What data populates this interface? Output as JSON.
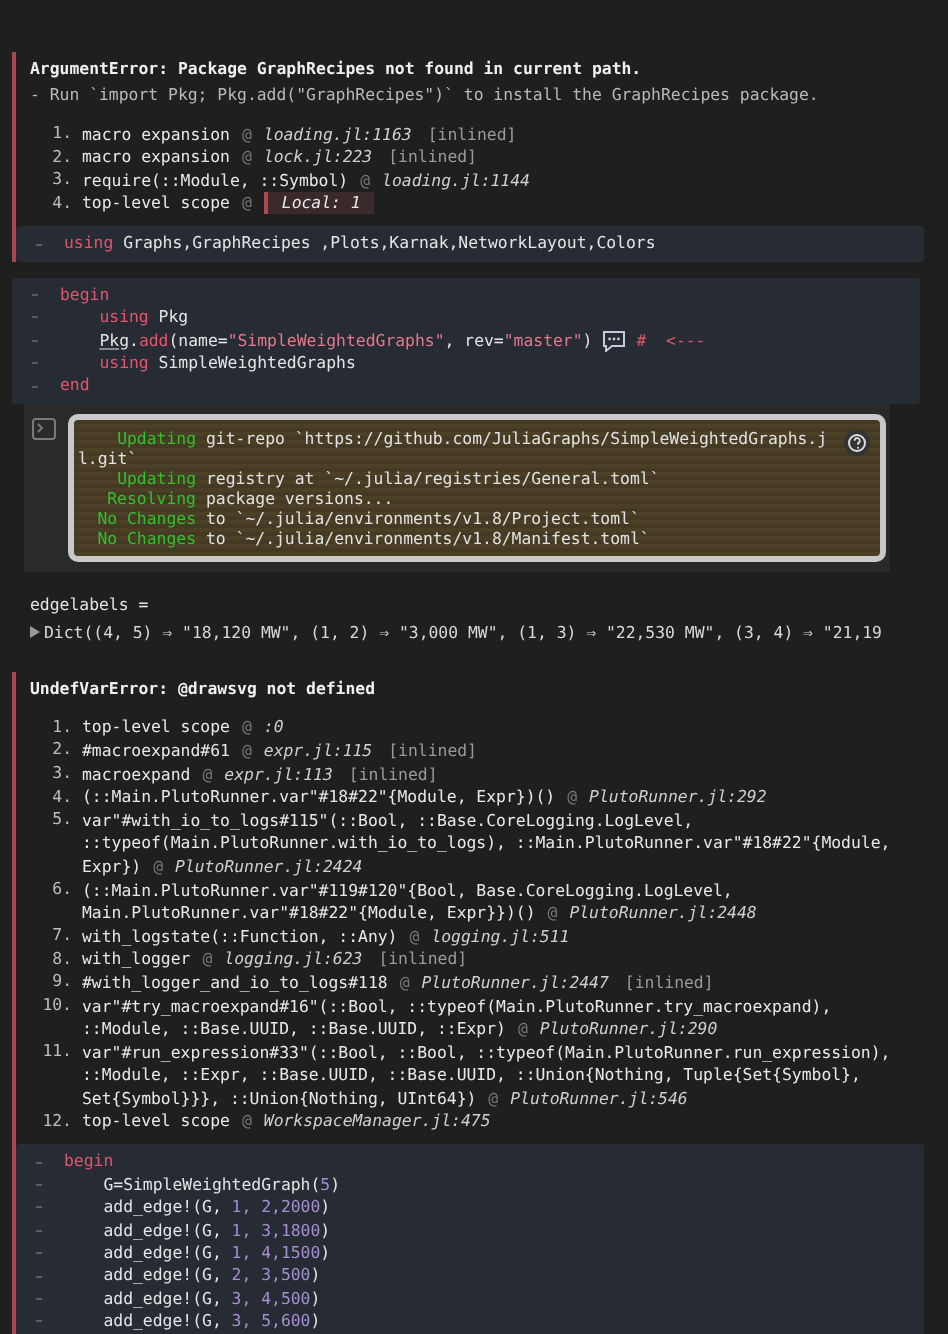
{
  "cells": [
    {
      "error": {
        "title": "ArgumentError: Package GraphRecipes not found in current path.",
        "hint": "- Run `import Pkg; Pkg.add(\"GraphRecipes\")` to install the GraphRecipes package.",
        "frames": [
          {
            "num": "1.",
            "call": [
              "macro expansion"
            ],
            "at": "@",
            "loc": {
              "kind": "file",
              "text": "loading.jl:1163"
            },
            "tag": "[inlined]"
          },
          {
            "num": "2.",
            "call": [
              "macro expansion"
            ],
            "at": "@",
            "loc": {
              "kind": "file",
              "text": "lock.jl:223"
            },
            "tag": "[inlined]"
          },
          {
            "num": "3.",
            "call": [
              "require(::Module, ::Symbol)"
            ],
            "at": "@",
            "loc": {
              "kind": "file",
              "text": "loading.jl:1144"
            }
          },
          {
            "num": "4.",
            "call": [
              "top-level scope"
            ],
            "at": "@",
            "loc": {
              "kind": "local",
              "text": "Local: 1"
            }
          }
        ]
      },
      "code": [
        [
          {
            "kind": "kw",
            "text": "using"
          },
          {
            "kind": "plain",
            "text": " Graphs,GraphRecipes ,Plots,Karnak,NetworkLayout,Colors"
          }
        ]
      ]
    },
    {
      "code": [
        [
          {
            "kind": "kw",
            "text": "begin"
          }
        ],
        [
          {
            "kind": "kw",
            "text": "    using"
          },
          {
            "kind": "plain",
            "text": " Pkg"
          }
        ],
        [
          {
            "kind": "link",
            "text": "    Pkg"
          },
          {
            "kind": "plain",
            "text": "."
          },
          {
            "kind": "fn",
            "text": "add"
          },
          {
            "kind": "plain",
            "text": "(name="
          },
          {
            "kind": "str",
            "text": "\"SimpleWeightedGraphs\""
          },
          {
            "kind": "plain",
            "text": ", rev="
          },
          {
            "kind": "str",
            "text": "\"master\""
          },
          {
            "kind": "plain",
            "text": ")"
          },
          {
            "kind": "note"
          },
          {
            "kind": "com",
            "text": "#  <---"
          }
        ],
        [
          {
            "kind": "kw",
            "text": "    using"
          },
          {
            "kind": "plain",
            "text": " SimpleWeightedGraphs"
          }
        ],
        [
          {
            "kind": "kw",
            "text": "end"
          }
        ]
      ],
      "logs": [
        {
          "status": "Updating",
          "text": "git-repo `https://github.com/JuliaGraphs/SimpleWeightedGraphs.j"
        },
        {
          "text": "l.git`"
        },
        {
          "status": "Updating",
          "text": "registry at `~/.julia/registries/General.toml`"
        },
        {
          "status": "Resolving",
          "text": "package versions..."
        },
        {
          "status": "No Changes",
          "text": "to `~/.julia/environments/v1.8/Project.toml`"
        },
        {
          "status": "No Changes",
          "text": "to `~/.julia/environments/v1.8/Manifest.toml`"
        }
      ]
    },
    {
      "output": {
        "name": "edgelabels =",
        "expanded": false,
        "value": "Dict((4, 5) ⇒ \"18,120 MW\", (1, 2) ⇒ \"3,000 MW\", (1, 3) ⇒ \"22,530 MW\", (3, 4) ⇒ \"21,19"
      }
    },
    {
      "error": {
        "title": "UndefVarError: @drawsvg not defined",
        "frames": [
          {
            "num": "1.",
            "call": [
              "top-level scope"
            ],
            "at": "@",
            "loc": {
              "kind": "file",
              "text": ":0"
            }
          },
          {
            "num": "2.",
            "call": [
              "#macroexpand#61"
            ],
            "at": "@",
            "loc": {
              "kind": "file",
              "text": "expr.jl:115"
            },
            "tag": "[inlined]"
          },
          {
            "num": "3.",
            "call": [
              "macroexpand"
            ],
            "at": "@",
            "loc": {
              "kind": "file",
              "text": "expr.jl:113"
            },
            "tag": "[inlined]"
          },
          {
            "num": "4.",
            "call": [
              "(::Main.PlutoRunner.var\"#18#22\"{Module, Expr})()"
            ],
            "at": "@",
            "loc": {
              "kind": "file",
              "text": "PlutoRunner.jl:292"
            }
          },
          {
            "num": "5.",
            "call": [
              "var\"#with_io_to_logs#115\"(::Bool, ::Base.CoreLogging.LogLevel,",
              "::typeof(Main.PlutoRunner.with_io_to_logs), ::Main.PlutoRunner.var\"#18#22\"{Module,",
              "Expr})"
            ],
            "at": "@",
            "loc": {
              "kind": "file",
              "text": "PlutoRunner.jl:2424"
            }
          },
          {
            "num": "6.",
            "call": [
              "(::Main.PlutoRunner.var\"#119#120\"{Bool, Base.CoreLogging.LogLevel,",
              "Main.PlutoRunner.var\"#18#22\"{Module, Expr}})()"
            ],
            "at": "@",
            "loc": {
              "kind": "file",
              "text": "PlutoRunner.jl:2448"
            }
          },
          {
            "num": "7.",
            "call": [
              "with_logstate(::Function, ::Any)"
            ],
            "at": "@",
            "loc": {
              "kind": "file",
              "text": "logging.jl:511"
            }
          },
          {
            "num": "8.",
            "call": [
              "with_logger"
            ],
            "at": "@",
            "loc": {
              "kind": "file",
              "text": "logging.jl:623"
            },
            "tag": "[inlined]"
          },
          {
            "num": "9.",
            "call": [
              "#with_logger_and_io_to_logs#118"
            ],
            "at": "@",
            "loc": {
              "kind": "file",
              "text": "PlutoRunner.jl:2447"
            },
            "tag": "[inlined]"
          },
          {
            "num": "10.",
            "call": [
              "var\"#try_macroexpand#16\"(::Bool, ::typeof(Main.PlutoRunner.try_macroexpand),",
              "::Module, ::Base.UUID, ::Base.UUID, ::Expr)"
            ],
            "at": "@",
            "loc": {
              "kind": "file",
              "text": "PlutoRunner.jl:290"
            }
          },
          {
            "num": "11.",
            "call": [
              "var\"#run_expression#33\"(::Bool, ::Bool, ::typeof(Main.PlutoRunner.run_expression),",
              "::Module, ::Expr, ::Base.UUID, ::Base.UUID, ::Union{Nothing, Tuple{Set{Symbol},",
              "Set{Symbol}}}, ::Union{Nothing, UInt64})"
            ],
            "at": "@",
            "loc": {
              "kind": "file",
              "text": "PlutoRunner.jl:546"
            }
          },
          {
            "num": "12.",
            "call": [
              "top-level scope"
            ],
            "at": "@",
            "loc": {
              "kind": "file",
              "text": "WorkspaceManager.jl:475"
            }
          }
        ]
      },
      "code": [
        [
          {
            "kind": "kw",
            "text": "begin"
          }
        ],
        [
          {
            "kind": "plain",
            "text": "    G=SimpleWeightedGraph("
          },
          {
            "kind": "num",
            "text": "5"
          },
          {
            "kind": "plain",
            "text": ")"
          }
        ],
        [
          {
            "kind": "plain",
            "text": "    add_edge!(G,"
          },
          {
            "kind": "num",
            "text": " 1, 2,2000"
          },
          {
            "kind": "plain",
            "text": ")"
          }
        ],
        [
          {
            "kind": "plain",
            "text": "    add_edge!(G,"
          },
          {
            "kind": "num",
            "text": " 1, 3,1800"
          },
          {
            "kind": "plain",
            "text": ")"
          }
        ],
        [
          {
            "kind": "plain",
            "text": "    add_edge!(G,"
          },
          {
            "kind": "num",
            "text": " 1, 4,1500"
          },
          {
            "kind": "plain",
            "text": ")"
          }
        ],
        [
          {
            "kind": "plain",
            "text": "    add_edge!(G,"
          },
          {
            "kind": "num",
            "text": " 2, 3,500"
          },
          {
            "kind": "plain",
            "text": ")"
          }
        ],
        [
          {
            "kind": "plain",
            "text": "    add_edge!(G,"
          },
          {
            "kind": "num",
            "text": " 3, 4,500"
          },
          {
            "kind": "plain",
            "text": ")"
          }
        ],
        [
          {
            "kind": "plain",
            "text": "    add_edge!(G,"
          },
          {
            "kind": "num",
            "text": " 3, 5,600"
          },
          {
            "kind": "plain",
            "text": ")"
          }
        ]
      ]
    }
  ]
}
